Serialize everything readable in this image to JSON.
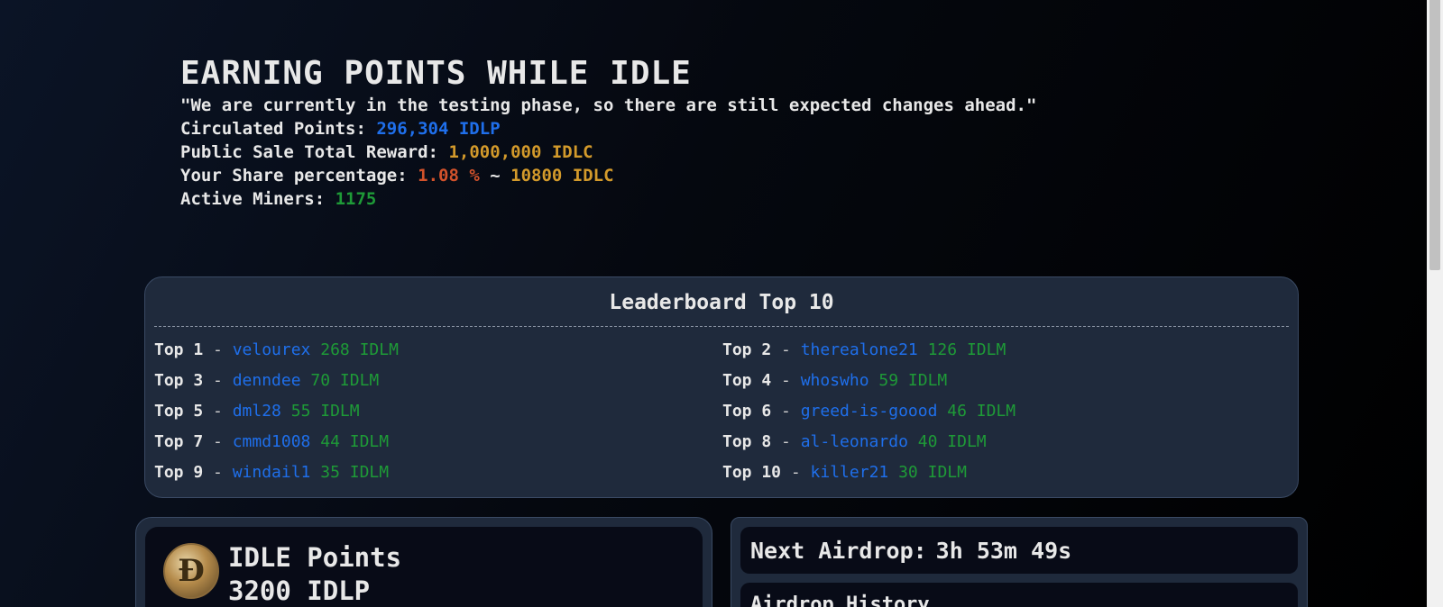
{
  "header": {
    "title": "EARNING POINTS WHILE IDLE",
    "notice": "\"We are currently in the testing phase, so there are still expected changes ahead.\"",
    "circulated_label": "Circulated Points:",
    "circulated_value": "296,304 IDLP",
    "public_sale_label": "Public Sale Total Reward:",
    "public_sale_value": "1,000,000 IDLC",
    "share_label": "Your Share percentage:",
    "share_percent": "1.08 %",
    "share_approx": "~",
    "share_value": "10800 IDLC",
    "active_miners_label": "Active Miners:",
    "active_miners_value": "1175"
  },
  "leaderboard": {
    "title": "Leaderboard Top 10",
    "entries": [
      {
        "rank": "Top 1",
        "user": "velourex",
        "points": "268 IDLM"
      },
      {
        "rank": "Top 2",
        "user": "therealone21",
        "points": "126 IDLM"
      },
      {
        "rank": "Top 3",
        "user": "denndee",
        "points": "70 IDLM"
      },
      {
        "rank": "Top 4",
        "user": "whoswho",
        "points": "59 IDLM"
      },
      {
        "rank": "Top 5",
        "user": "dml28",
        "points": "55 IDLM"
      },
      {
        "rank": "Top 6",
        "user": "greed-is-goood",
        "points": "46 IDLM"
      },
      {
        "rank": "Top 7",
        "user": "cmmd1008",
        "points": "44 IDLM"
      },
      {
        "rank": "Top 8",
        "user": "al-leonardo",
        "points": "40 IDLM"
      },
      {
        "rank": "Top 9",
        "user": "windail1",
        "points": "35 IDLM"
      },
      {
        "rank": "Top 10",
        "user": "killer21",
        "points": "30 IDLM"
      }
    ]
  },
  "idle_points": {
    "title": "IDLE Points",
    "value": "3200 IDLP",
    "icon": "coin-icon"
  },
  "airdrop": {
    "label": "Next Airdrop:",
    "countdown": "3h 53m 49s",
    "history_title": "Airdrop History"
  },
  "colors": {
    "blue": "#1f6feb",
    "gold": "#d39a2b",
    "red": "#d2522b",
    "green": "#1e9a37",
    "card_bg": "#1f2a3c"
  }
}
